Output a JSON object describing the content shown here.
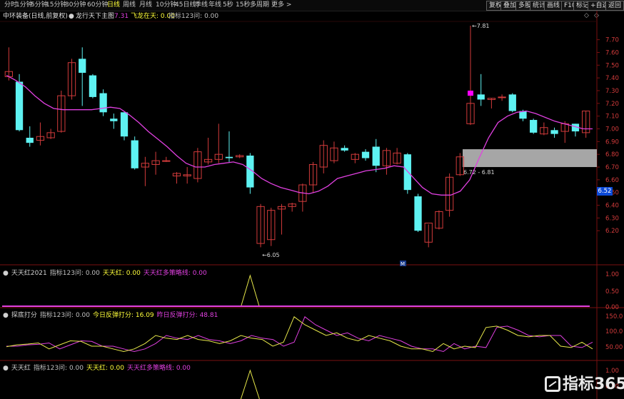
{
  "topbar": {
    "periods": [
      "分时",
      "1分钟",
      "5分钟",
      "15分钟",
      "30分钟",
      "60分钟",
      "日线",
      "周线",
      "月线",
      "10分钟",
      "45日线",
      "季线",
      "年线",
      "5秒",
      "15秒",
      "多周期",
      "更多 >"
    ],
    "active_period": "日线",
    "buttons": [
      "复权",
      "叠加",
      "多股",
      "统计",
      "画线",
      "F10",
      "标记",
      "+自选",
      "返回"
    ]
  },
  "info": {
    "stock": "中环装备(日线,前复权)",
    "indicator_dot": "●",
    "indicator_name": "龙行天下主图",
    "indicator_value": "7.31",
    "signal": "飞龙在天: 0.00",
    "extra": "指标123问: 0.00"
  },
  "price_axis": {
    "ticks": [
      "7.70",
      "7.60",
      "7.50",
      "7.40",
      "7.30",
      "7.20",
      "7.10",
      "7.00",
      "6.90",
      "6.80",
      "6.70",
      "6.60",
      "6.50",
      "6.40",
      "6.30",
      "6.20"
    ],
    "current_price": "6.52"
  },
  "annotations": {
    "high": "7.81",
    "low": "6.05",
    "zone": "6.72 - 6.81",
    "marker": "M"
  },
  "panes": {
    "p1": {
      "name": "天天红2021",
      "f1": "指标123问: 0.00",
      "f2": "天天红: 0.00",
      "f3": "天天红多策略线: 0.00",
      "ticks": [
        "1.00",
        "0.50",
        "0.00"
      ]
    },
    "p2": {
      "name": "探底打分",
      "f1": "指标123问: 0.00",
      "f2": "今日反弹打分: 16.09",
      "f3": "昨日反弹打分: 48.81",
      "ticks": [
        "150.0",
        "100.0",
        "50.00"
      ]
    },
    "p3": {
      "name": "天天红",
      "f1": "指标123问: 0.00",
      "f2": "天天红: 0.00",
      "f3": "天天红多策略线: 0.00",
      "ticks": [
        "1.00",
        "0.50"
      ]
    }
  },
  "watermark": {
    "text": "指标365"
  },
  "colors": {
    "up": "#d23b3b",
    "down": "#5ef2f2",
    "ma": "#e040e0",
    "score_today": "#e8e84a",
    "score_yesterday": "#e040e0",
    "signal_line": "#e040e0",
    "signal_spike": "#e8e84a",
    "highlight": "#ff00ff"
  },
  "chart_data": {
    "type": "candlestick",
    "ylim": [
      6.05,
      7.81
    ],
    "candles": [
      {
        "o": 7.41,
        "h": 7.64,
        "l": 7.38,
        "c": 7.45
      },
      {
        "o": 7.37,
        "h": 7.43,
        "l": 6.98,
        "c": 6.99
      },
      {
        "o": 6.93,
        "h": 7.02,
        "l": 6.86,
        "c": 6.89
      },
      {
        "o": 6.91,
        "h": 7.05,
        "l": 6.87,
        "c": 6.94
      },
      {
        "o": 6.93,
        "h": 7.0,
        "l": 6.92,
        "c": 6.97
      },
      {
        "o": 6.98,
        "h": 7.3,
        "l": 6.97,
        "c": 7.26
      },
      {
        "o": 7.26,
        "h": 7.55,
        "l": 7.23,
        "c": 7.52
      },
      {
        "o": 7.55,
        "h": 7.64,
        "l": 7.18,
        "c": 7.44
      },
      {
        "o": 7.42,
        "h": 7.43,
        "l": 7.24,
        "c": 7.25
      },
      {
        "o": 7.28,
        "h": 7.31,
        "l": 7.1,
        "c": 7.13
      },
      {
        "o": 7.08,
        "h": 7.12,
        "l": 7.0,
        "c": 7.06
      },
      {
        "o": 7.13,
        "h": 7.13,
        "l": 6.91,
        "c": 6.94
      },
      {
        "o": 6.91,
        "h": 6.94,
        "l": 6.68,
        "c": 6.69
      },
      {
        "o": 6.7,
        "h": 6.78,
        "l": 6.55,
        "c": 6.73
      },
      {
        "o": 6.72,
        "h": 6.82,
        "l": 6.64,
        "c": 6.75
      },
      {
        "o": 6.75,
        "h": 6.78,
        "l": 6.74,
        "c": 6.75
      },
      {
        "o": 6.63,
        "h": 6.66,
        "l": 6.57,
        "c": 6.65
      },
      {
        "o": 6.63,
        "h": 6.7,
        "l": 6.57,
        "c": 6.64
      },
      {
        "o": 6.61,
        "h": 6.85,
        "l": 6.58,
        "c": 6.82
      },
      {
        "o": 6.74,
        "h": 6.93,
        "l": 6.72,
        "c": 6.76
      },
      {
        "o": 6.76,
        "h": 7.04,
        "l": 6.73,
        "c": 6.8
      },
      {
        "o": 6.78,
        "h": 6.98,
        "l": 6.74,
        "c": 6.77
      },
      {
        "o": 6.78,
        "h": 6.8,
        "l": 6.77,
        "c": 6.79
      },
      {
        "o": 6.79,
        "h": 6.81,
        "l": 6.49,
        "c": 6.54
      },
      {
        "o": 6.1,
        "h": 6.41,
        "l": 6.07,
        "c": 6.39
      },
      {
        "o": 6.13,
        "h": 6.38,
        "l": 6.08,
        "c": 6.36
      },
      {
        "o": 6.37,
        "h": 6.41,
        "l": 6.17,
        "c": 6.39
      },
      {
        "o": 6.39,
        "h": 6.42,
        "l": 6.35,
        "c": 6.41
      },
      {
        "o": 6.43,
        "h": 6.57,
        "l": 6.35,
        "c": 6.56
      },
      {
        "o": 6.56,
        "h": 6.74,
        "l": 6.5,
        "c": 6.72
      },
      {
        "o": 6.7,
        "h": 6.91,
        "l": 6.65,
        "c": 6.87
      },
      {
        "o": 6.75,
        "h": 6.9,
        "l": 6.73,
        "c": 6.85
      },
      {
        "o": 6.85,
        "h": 6.87,
        "l": 6.82,
        "c": 6.83
      },
      {
        "o": 6.76,
        "h": 6.81,
        "l": 6.73,
        "c": 6.8
      },
      {
        "o": 6.82,
        "h": 6.84,
        "l": 6.75,
        "c": 6.77
      },
      {
        "o": 6.86,
        "h": 6.92,
        "l": 6.66,
        "c": 6.71
      },
      {
        "o": 6.71,
        "h": 6.85,
        "l": 6.64,
        "c": 6.83
      },
      {
        "o": 6.73,
        "h": 6.85,
        "l": 6.72,
        "c": 6.81
      },
      {
        "o": 6.8,
        "h": 6.81,
        "l": 6.49,
        "c": 6.52
      },
      {
        "o": 6.47,
        "h": 6.49,
        "l": 6.19,
        "c": 6.2
      },
      {
        "o": 6.11,
        "h": 6.25,
        "l": 6.07,
        "c": 6.26
      },
      {
        "o": 6.22,
        "h": 6.36,
        "l": 6.21,
        "c": 6.35
      },
      {
        "o": 6.36,
        "h": 6.65,
        "l": 6.31,
        "c": 6.62
      },
      {
        "o": 6.64,
        "h": 6.81,
        "l": 6.63,
        "c": 6.78
      },
      {
        "o": 7.04,
        "h": 7.81,
        "l": 7.03,
        "c": 7.2
      },
      {
        "o": 7.27,
        "h": 7.43,
        "l": 7.18,
        "c": 7.23
      },
      {
        "o": 7.23,
        "h": 7.24,
        "l": 7.16,
        "c": 7.24
      },
      {
        "o": 7.25,
        "h": 7.27,
        "l": 7.22,
        "c": 7.25
      },
      {
        "o": 7.27,
        "h": 7.28,
        "l": 7.13,
        "c": 7.14
      },
      {
        "o": 7.14,
        "h": 7.15,
        "l": 7.06,
        "c": 7.08
      },
      {
        "o": 7.07,
        "h": 7.08,
        "l": 6.96,
        "c": 6.97
      },
      {
        "o": 6.96,
        "h": 7.05,
        "l": 6.95,
        "c": 7.01
      },
      {
        "o": 6.99,
        "h": 7.01,
        "l": 6.93,
        "c": 6.96
      },
      {
        "o": 6.98,
        "h": 7.06,
        "l": 6.89,
        "c": 7.04
      },
      {
        "o": 7.04,
        "h": 7.04,
        "l": 6.94,
        "c": 6.98
      },
      {
        "o": 6.97,
        "h": 7.14,
        "l": 6.93,
        "c": 7.14
      }
    ],
    "ma": [
      7.42,
      7.38,
      7.33,
      7.26,
      7.2,
      7.16,
      7.15,
      7.15,
      7.15,
      7.15,
      7.16,
      7.17,
      7.16,
      7.11,
      7.05,
      6.98,
      6.92,
      6.86,
      6.79,
      6.73,
      6.7,
      6.7,
      6.72,
      6.73,
      6.74,
      6.72,
      6.67,
      6.61,
      6.57,
      6.54,
      6.52,
      6.5,
      6.49,
      6.51,
      6.55,
      6.61,
      6.63,
      6.65,
      6.67,
      6.68,
      6.69,
      6.71,
      6.7,
      6.62,
      6.54,
      6.49,
      6.48,
      6.48,
      6.51,
      6.6,
      6.77,
      6.93,
      7.05,
      7.1,
      7.13,
      7.14,
      7.12,
      7.09,
      7.06,
      7.04,
      7.02,
      7.0,
      7.0
    ],
    "score_today": [
      38,
      45,
      48,
      52,
      30,
      45,
      60,
      58,
      40,
      40,
      30,
      20,
      30,
      50,
      80,
      70,
      65,
      80,
      65,
      60,
      50,
      60,
      80,
      70,
      65,
      40,
      55,
      150,
      120,
      100,
      80,
      90,
      70,
      60,
      80,
      70,
      60,
      40,
      30,
      30,
      20,
      50,
      30,
      40,
      35,
      110,
      115,
      100,
      80,
      75,
      80,
      80,
      40,
      35,
      55,
      30
    ],
    "score_yesterday": [
      40,
      40,
      45,
      47,
      52,
      30,
      45,
      60,
      58,
      40,
      40,
      30,
      20,
      30,
      50,
      80,
      70,
      65,
      80,
      65,
      60,
      50,
      60,
      80,
      70,
      65,
      40,
      55,
      150,
      120,
      100,
      80,
      90,
      70,
      60,
      80,
      70,
      60,
      40,
      30,
      30,
      20,
      50,
      30,
      40,
      35,
      110,
      115,
      100,
      80,
      75,
      80,
      80,
      40,
      35,
      55
    ],
    "signal_spike_index": 23
  }
}
